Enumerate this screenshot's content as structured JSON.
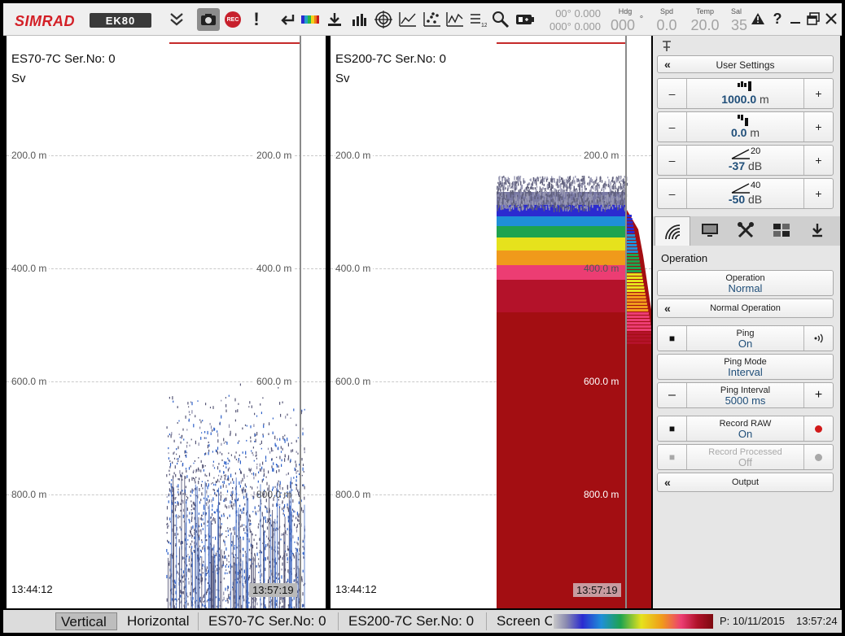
{
  "app": {
    "brand": "SIMRAD",
    "product": "EK80"
  },
  "toolbar": {
    "position_lat": "00° 0.000",
    "position_lon": "000° 0.000",
    "heading": {
      "label": "Hdg",
      "value": "000",
      "unit": "°"
    },
    "speed": {
      "label": "Spd",
      "value": "0.0"
    },
    "temp": {
      "label": "Temp",
      "value": "20.0"
    },
    "salinity": {
      "label": "Sal",
      "value": "35"
    },
    "icons": [
      "collapse-chevrons-icon",
      "screenshot-camera-icon",
      "record-icon",
      "alarm-exclamation-icon",
      "undo-arrow-icon",
      "color-scale-icon",
      "download-icon",
      "bar-chart-icon",
      "target-icon",
      "trend-icon",
      "scatter-icon",
      "line-chart-icon",
      "numbered-list-icon",
      "magnifier-icon",
      "battery-icon",
      "warning-icon",
      "help-icon",
      "minimize-icon",
      "restore-icon",
      "close-icon"
    ],
    "rec_label": "REC"
  },
  "panels": [
    {
      "title": "ES70-7C Ser.No: 0",
      "subtitle": "Sv",
      "depths": [
        "200.0 m",
        "400.0 m",
        "600.0 m",
        "800.0 m"
      ],
      "start_time": "13:44:12",
      "end_time": "13:57:19"
    },
    {
      "title": "ES200-7C Ser.No: 0",
      "subtitle": "Sv",
      "depths": [
        "200.0 m",
        "400.0 m",
        "600.0 m",
        "800.0 m"
      ],
      "start_time": "13:44:12",
      "end_time": "13:57:19"
    }
  ],
  "right_panel": {
    "user_settings_label": "User Settings",
    "range": {
      "value": "1000.0",
      "unit": "m"
    },
    "start_range": {
      "value": "0.0",
      "unit": "m"
    },
    "gain1": {
      "value": "-37",
      "unit": "dB",
      "scale": "20"
    },
    "gain2": {
      "value": "-50",
      "unit": "dB",
      "scale": "40"
    },
    "tabs": [
      "transducer-tab-icon",
      "display-tab-icon",
      "setup-tools-tab-icon",
      "layout-tab-icon",
      "install-tab-icon"
    ],
    "section_title": "Operation",
    "operation": {
      "caption": "Operation",
      "value": "Normal"
    },
    "normal_operation_label": "Normal Operation",
    "ping": {
      "caption": "Ping",
      "value": "On"
    },
    "ping_mode": {
      "caption": "Ping Mode",
      "value": "Interval"
    },
    "ping_interval": {
      "caption": "Ping Interval",
      "value": "5000 ms"
    },
    "record_raw": {
      "caption": "Record RAW",
      "value": "On"
    },
    "record_processed": {
      "caption": "Record Processed",
      "value": "Off"
    },
    "output_label": "Output"
  },
  "statusbar": {
    "tabs": [
      "Vertical",
      "Horizontal",
      "ES70-7C Ser.No: 0",
      "ES200-7C Ser.No: 0",
      "Screen C"
    ],
    "date": "P: 10/11/2015",
    "time": "13:57:24"
  },
  "colors": {
    "brand_red": "#d31f26",
    "echo_red": "#a30e12",
    "value_blue": "#1f4e79"
  }
}
